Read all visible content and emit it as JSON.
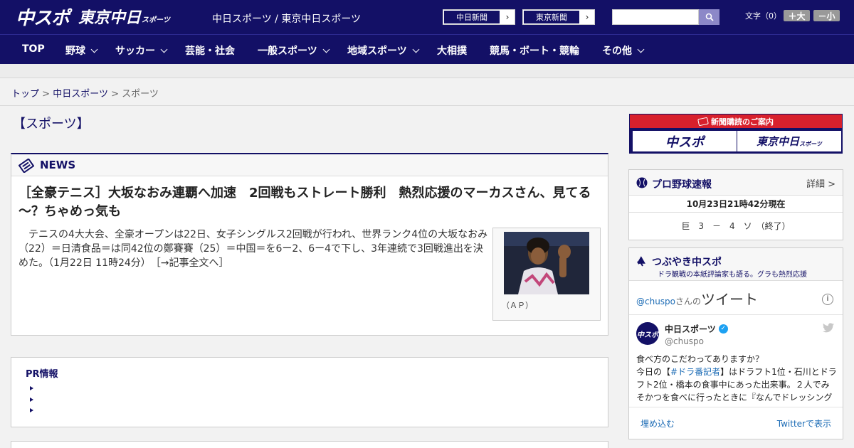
{
  "header": {
    "logo_chuspo": "中スポ",
    "logo_tokyo": "東京中日",
    "logo_tokyo_small": "スポーツ",
    "site_links": "中日スポーツ / 東京中日スポーツ",
    "paper1": "中日新聞",
    "paper2": "東京新聞",
    "fontsize_label": "文字（0）",
    "font_larger": "＋大",
    "font_smaller": "－小"
  },
  "nav": {
    "items": [
      "TOP",
      "野球",
      "サッカー",
      "芸能・社会",
      "一般スポーツ",
      "地域スポーツ",
      "大相撲",
      "競馬・ボート・競輪",
      "その他"
    ]
  },
  "breadcrumb": {
    "top": "トップ",
    "chunichi": "中日スポーツ",
    "current": "スポーツ",
    "sep": ">"
  },
  "page_title": "【スポーツ】",
  "news": {
    "label": "NEWS",
    "headline": "［全豪テニス］大坂なおみ連覇へ加速　2回戦もストレート勝利　熱烈応援のマーカスさん、見てる～？ちゃめっ気も",
    "body": "　テニスの4大大会、全豪オープンは22日、女子シングルス2回戦が行われ、世界ランク4位の大坂なおみ（22）＝日清食品＝は同42位の鄭賽賽（25）＝中国＝を6ー2、6ー4で下し、3年連続で3回戦進出を決めた。（1月22日 11時24分）　［→記事全文へ］",
    "caption": "（ＡＰ）"
  },
  "pr": {
    "title": "PR情報"
  },
  "sidebar": {
    "subscribe": {
      "title": "新聞購読のご案内",
      "btn1": "中スポ",
      "btn2": "東京中日",
      "btn2_small": "スポーツ"
    },
    "baseball": {
      "title": "プロ野球速報",
      "detail": "詳細 >",
      "time": "10月23日21時42分現在",
      "score": "巨　3　－　4　ソ　（終了）"
    },
    "tweets": {
      "title": "つぶやき中スポ",
      "subtitle": "ドラ観戦の本紙評論家も語る。グラも熱烈応援",
      "handle_link": "@chuspo",
      "heading_suffix": "さんの",
      "heading_big": "ツイート",
      "info": "i",
      "avatar_text": "中スポ",
      "name": "中日スポーツ",
      "handle": "@chuspo",
      "text_line1": "食べ方のこだわってありますか？",
      "text_pre": "今日の【",
      "text_tag": "#ドラ番記者",
      "text_post": "】はドラフト1位・石川とドラフト2位・橋本の食事中にあった出来事。２人でみそかつを食べに行ったときに『なんでドレッシング",
      "embed": "埋め込む",
      "view": "Twitterで表示"
    }
  },
  "colors": {
    "navy": "#131066",
    "red": "#d8202c",
    "link": "#1b6bb5"
  }
}
